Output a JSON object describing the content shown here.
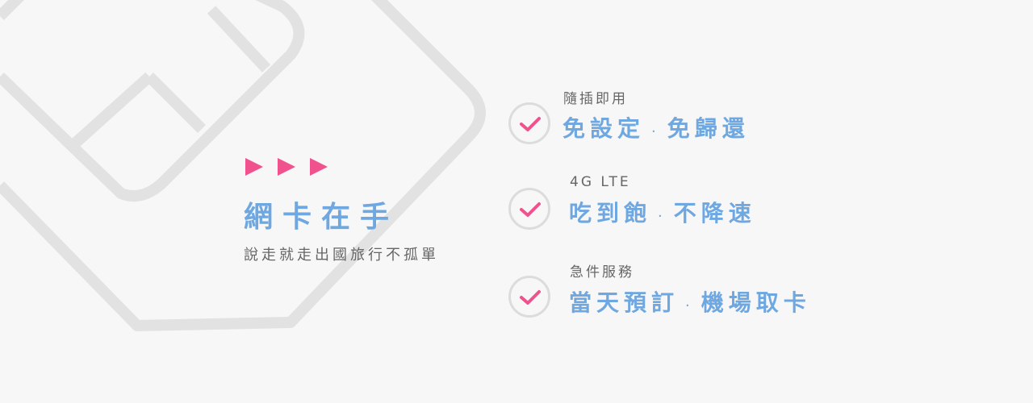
{
  "colors": {
    "accent_blue": "#6fa8e1",
    "accent_pink": "#f0528d",
    "outline_gray": "#e0e0e0",
    "text_gray": "#666666"
  },
  "hero": {
    "arrow_icon": "triangle-right-icon",
    "title": "網卡在手",
    "subtitle": "說走就走出國旅行不孤單"
  },
  "features": [
    {
      "icon": "checkmark-circle-icon",
      "label_small": "隨插即用",
      "label_big_a": "免設定",
      "label_big_b": "免歸還"
    },
    {
      "icon": "checkmark-circle-icon",
      "label_small": "4G LTE",
      "label_big_a": "吃到飽",
      "label_big_b": "不降速"
    },
    {
      "icon": "checkmark-circle-icon",
      "label_small": "急件服務",
      "label_big_a": "當天預訂",
      "label_big_b": "機場取卡"
    }
  ]
}
